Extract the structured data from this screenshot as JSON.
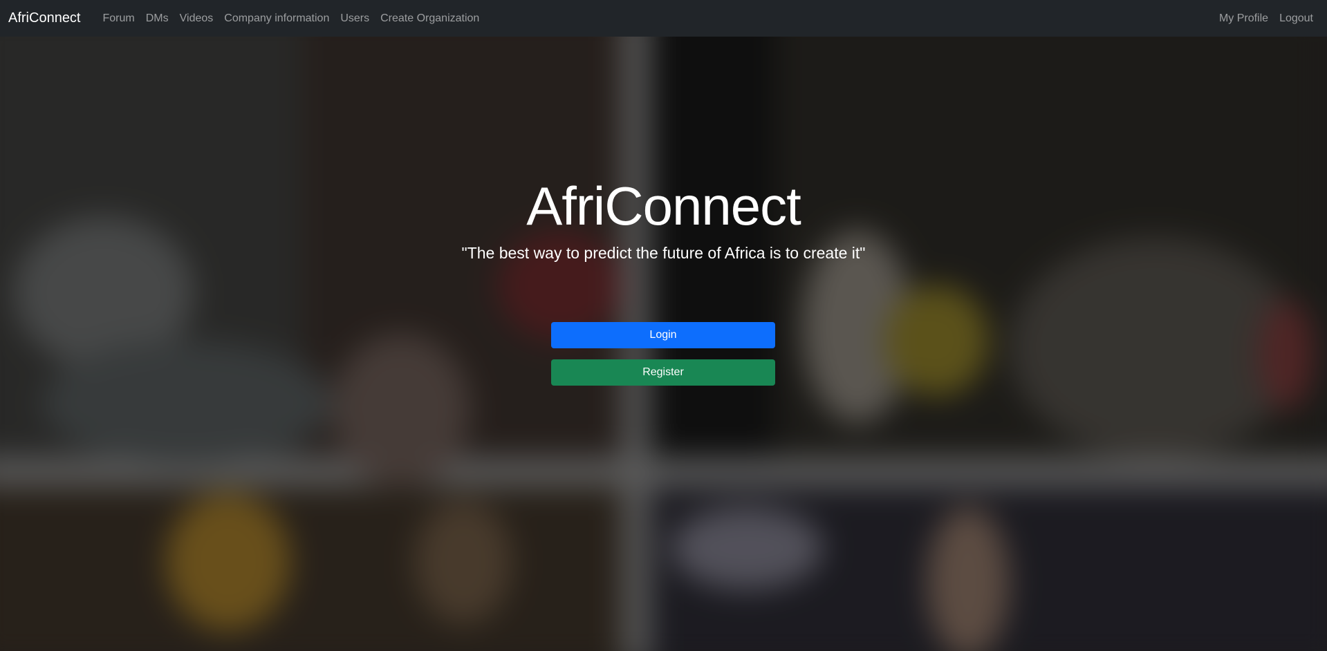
{
  "navbar": {
    "brand": "AfriConnect",
    "links": [
      "Forum",
      "DMs",
      "Videos",
      "Company information",
      "Users",
      "Create Organization"
    ],
    "right_links": [
      "My Profile",
      "Logout"
    ]
  },
  "hero": {
    "title": "AfriConnect",
    "quote": "\"The best way to predict the future of Africa is to create it\"",
    "login_label": "Login",
    "register_label": "Register"
  },
  "colors": {
    "navbar_bg": "#212529",
    "login_bg": "#0d6efd",
    "register_bg": "#198754"
  }
}
